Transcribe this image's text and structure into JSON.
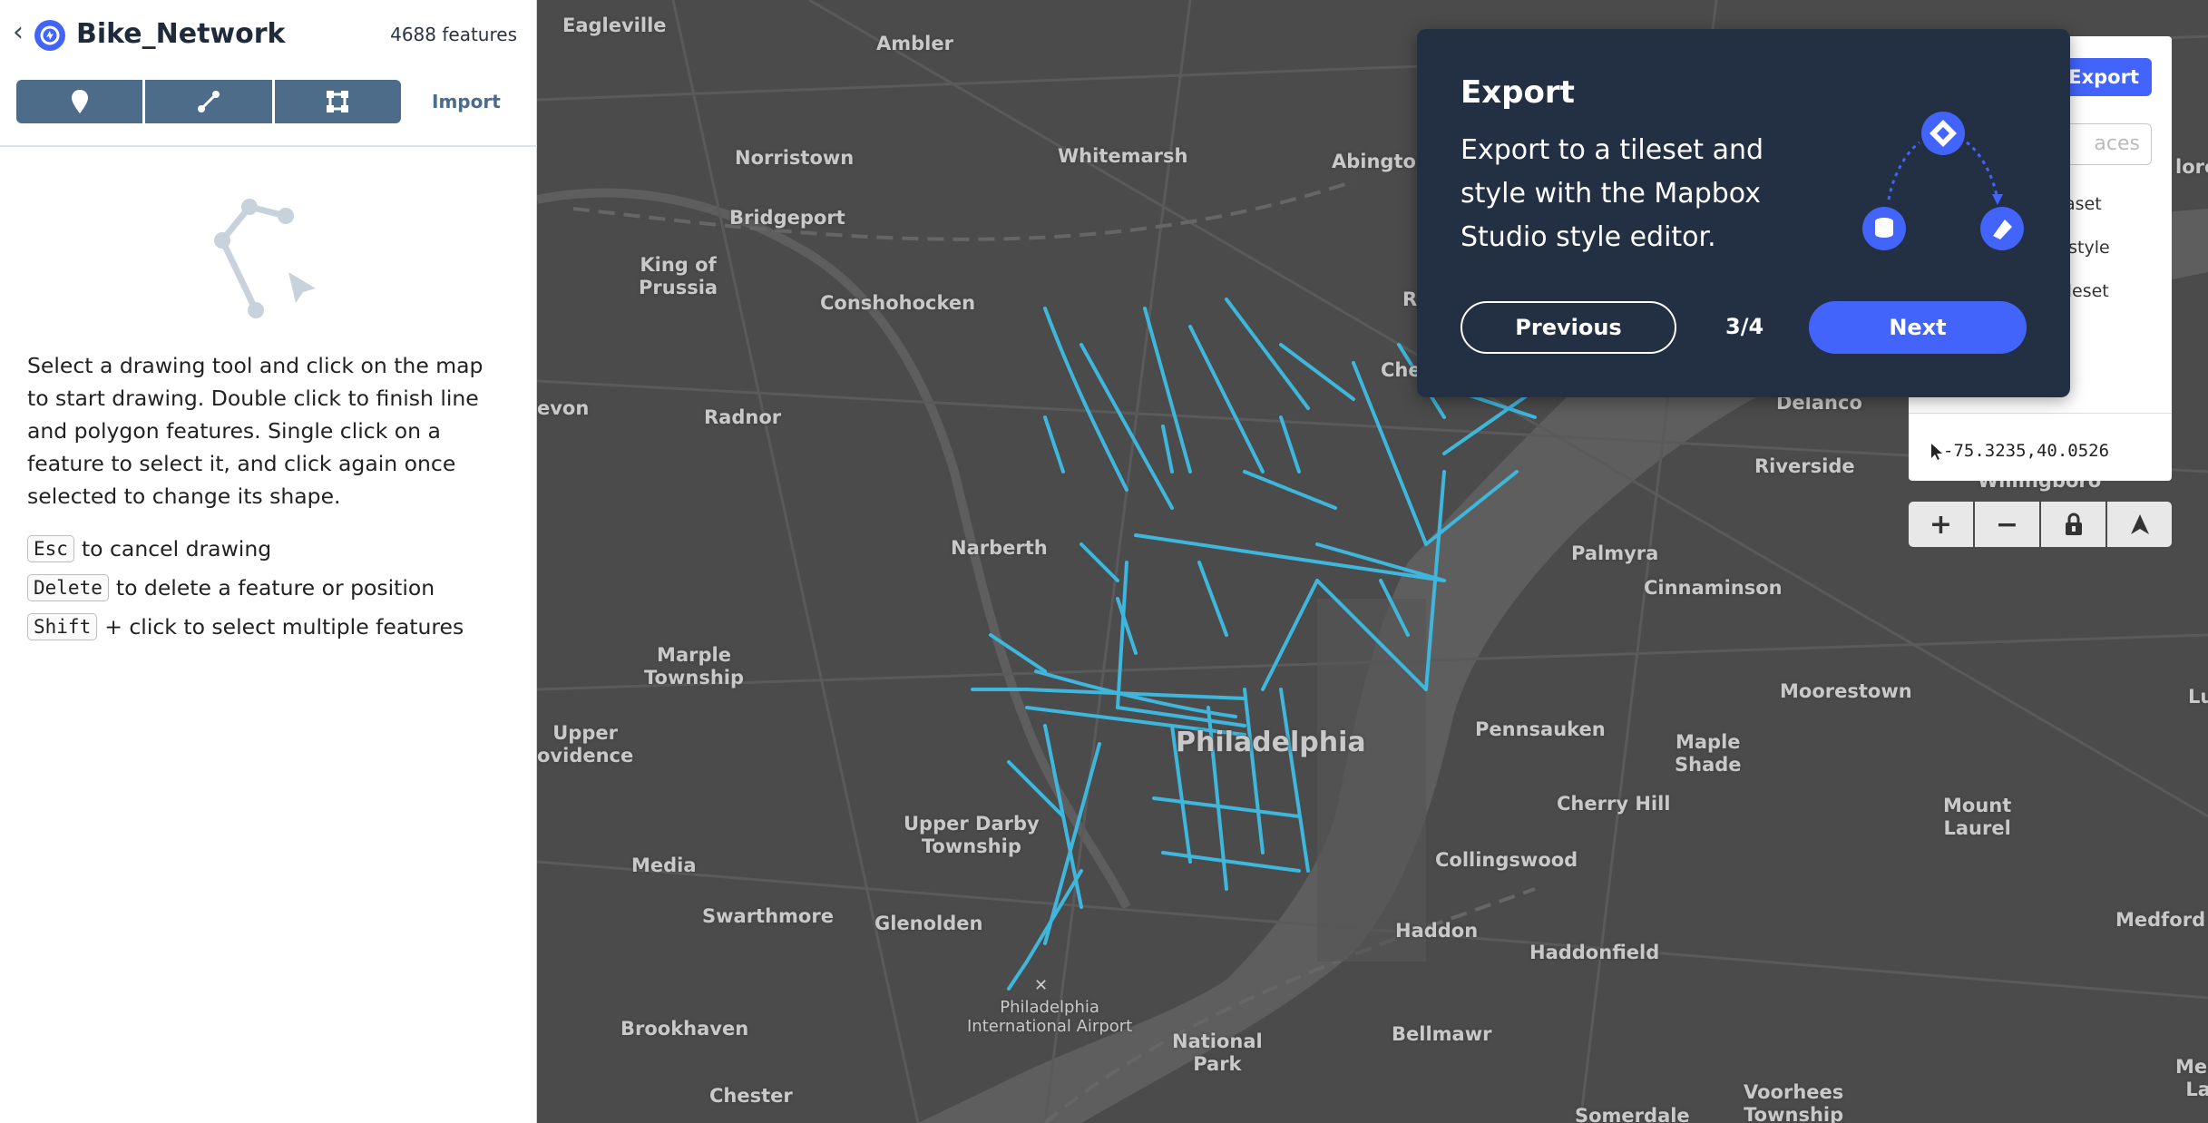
{
  "sidebar": {
    "dataset_name": "Bike_Network",
    "feature_count": "4688 features",
    "import_label": "Import",
    "tools": [
      "marker-tool",
      "line-tool",
      "polygon-tool"
    ],
    "instructions": "Select a drawing tool and click on the map to start drawing. Double click to finish line and polygon features. Single click on a feature to select it, and click again once selected to change its shape.",
    "shortcuts": [
      {
        "key": "Esc",
        "text": "to cancel drawing"
      },
      {
        "key": "Delete",
        "text": "to delete a feature or position"
      },
      {
        "key": "Shift",
        "text": "+ click to select multiple features"
      }
    ]
  },
  "map": {
    "places": [
      "Eagleville",
      "Ambler",
      "Norristown",
      "Whitemarsh",
      "Abington",
      "Bridgeport",
      "King of\nPrussia",
      "Conshohocken",
      "Radnor",
      "evon",
      "Narberth",
      "Marple\nTownship",
      "Upper\novidence",
      "Philadelphia",
      "Upper Darby\nTownship",
      "Media",
      "Swarthmore",
      "Glenolden",
      "Brookhaven",
      "Chester",
      "Philadelphia\nInternational Airport",
      "National\nPark",
      "Bellmawr",
      "Haddon",
      "Haddonfield",
      "Collingswood",
      "Cherry Hill",
      "Pennsauken",
      "Maple\nShade",
      "Moorestown",
      "Mount\nLaurel",
      "Palmyra",
      "Cinnaminson",
      "Riverside",
      "Delanco",
      "Willingboro",
      "Medford",
      "Lumbe",
      "Voorhees\nTownship",
      "Somerdale",
      "Che",
      "R",
      "lore",
      "Med\nLa"
    ],
    "line_color": "#3fb6dc"
  },
  "right_panel": {
    "export_label": "Export",
    "places_placeholder": "aces",
    "items": [
      "aset",
      "d style",
      "tileset"
    ],
    "coordinates": "-75.3235,40.0526",
    "controls": [
      "+",
      "−",
      "lock",
      "compass"
    ]
  },
  "tour": {
    "title": "Export",
    "body": "Export to a tileset and style with the Mapbox Studio style editor.",
    "previous_label": "Previous",
    "step": "3/4",
    "next_label": "Next"
  }
}
